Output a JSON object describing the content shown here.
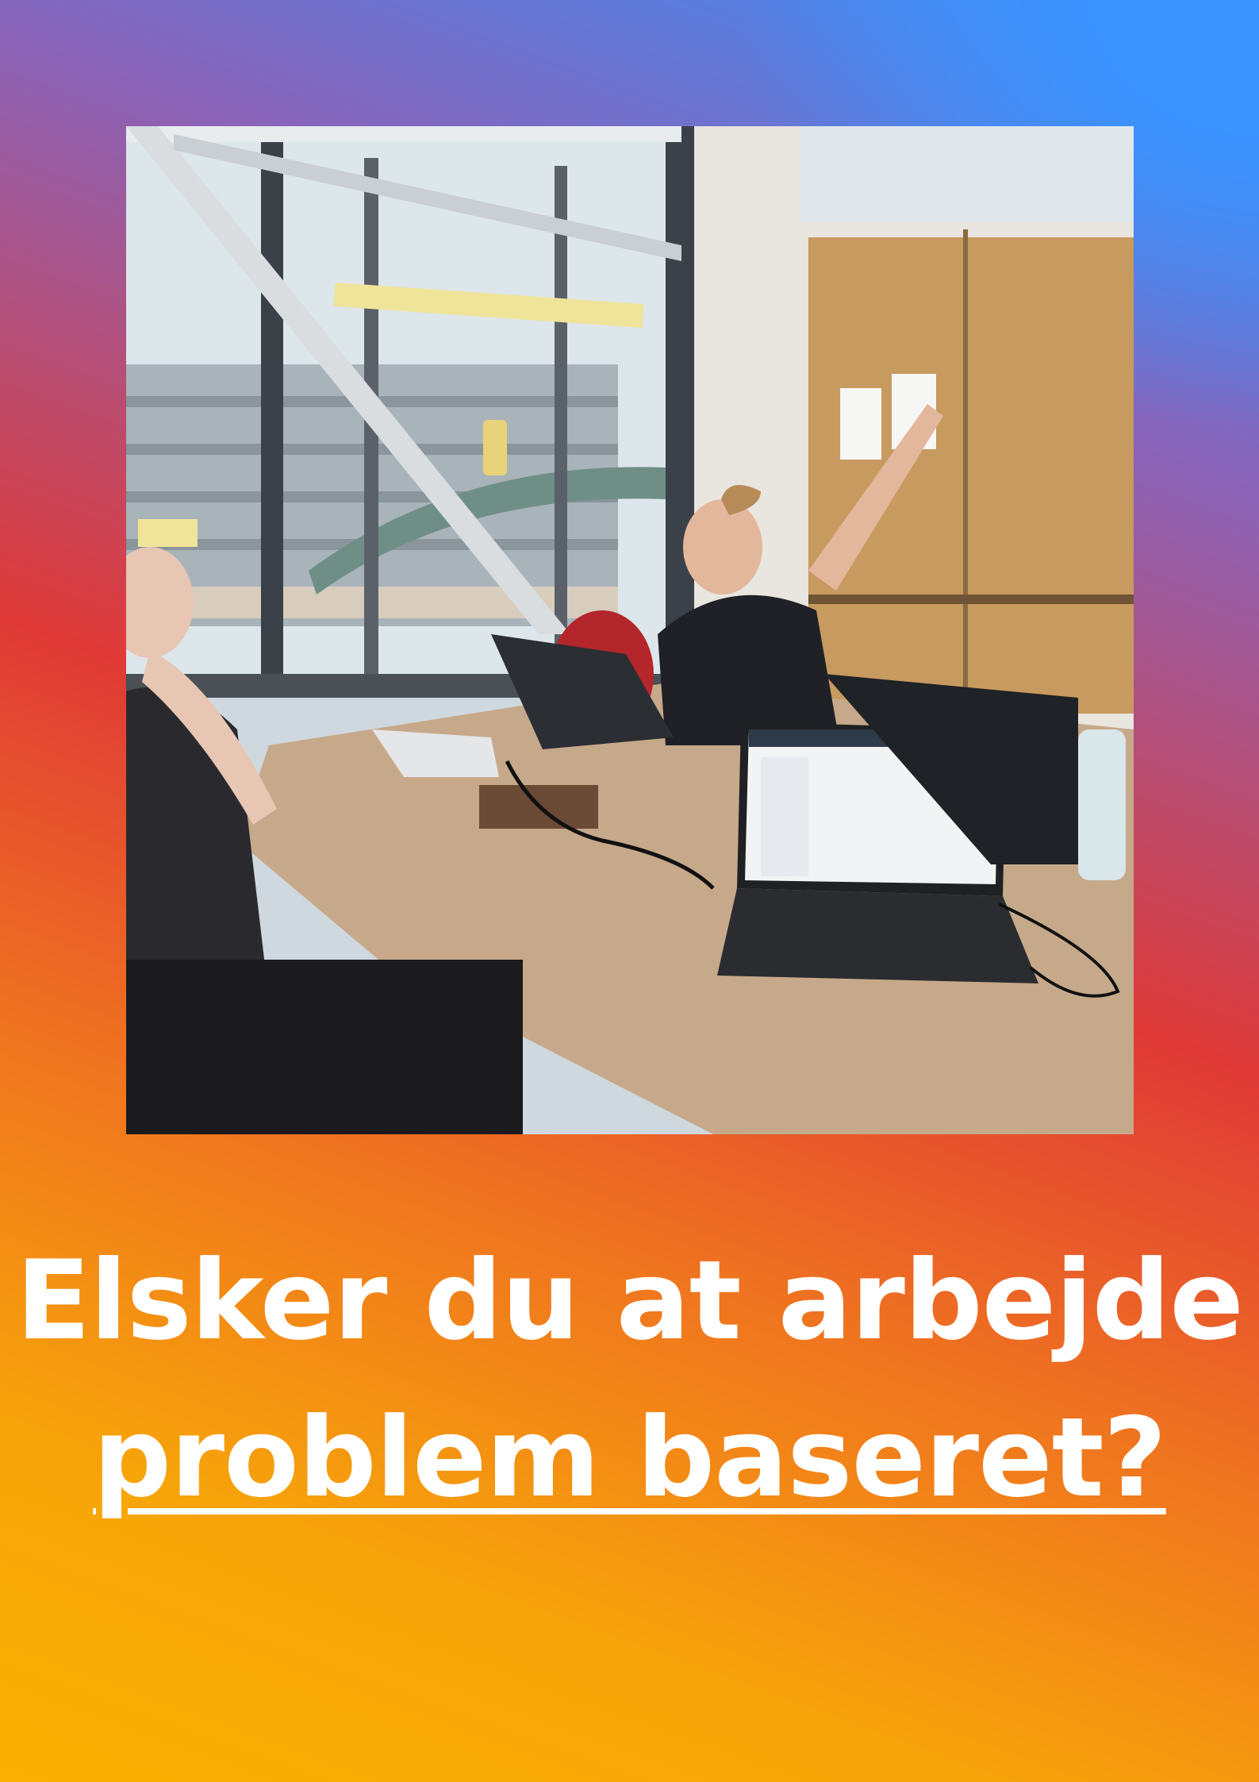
{
  "headline": {
    "line1": "Elsker du at arbejde",
    "line2": "problem baseret?"
  },
  "colors": {
    "text": "#ffffff",
    "gradient_top_right": "#3a93ff",
    "gradient_middle": "#e03a37",
    "gradient_bottom_left": "#f9b000"
  }
}
